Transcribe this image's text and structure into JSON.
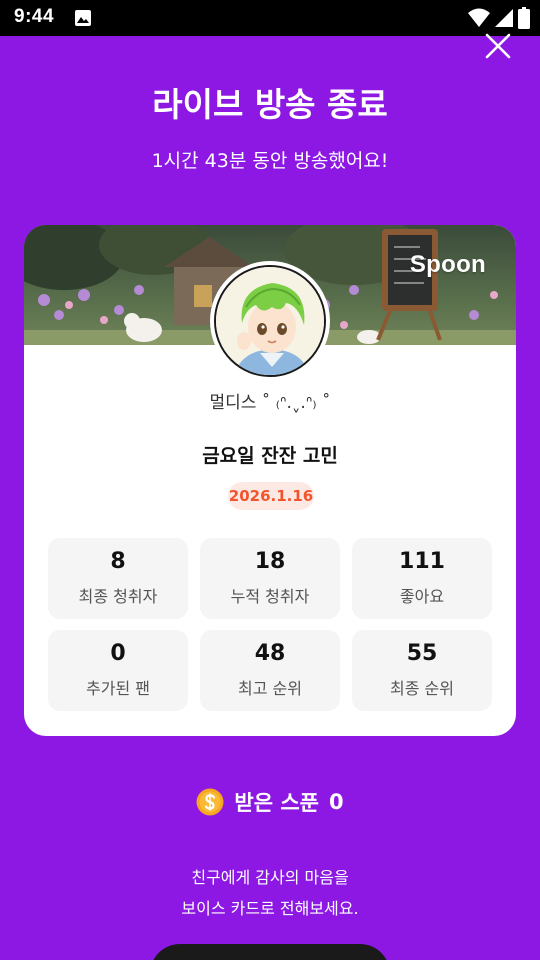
{
  "status_bar": {
    "time": "9:44",
    "icons": [
      "gallery-icon",
      "wifi-icon",
      "signal-icon",
      "battery-icon"
    ]
  },
  "header": {
    "title": "라이브 방송 종료",
    "subtitle": "1시간 43분 동안 방송했어요!",
    "close_icon": "close-icon"
  },
  "card": {
    "brand": "Spoon",
    "nickname": "멀디스 ˚ ₍ᐢ.ˬ.ᐢ₎ ˚",
    "show_title": "금요일 잔잔 고민",
    "date": "2026.1.16",
    "stats": [
      {
        "value": "8",
        "label": "최종 청취자"
      },
      {
        "value": "18",
        "label": "누적 청취자"
      },
      {
        "value": "111",
        "label": "좋아요"
      },
      {
        "value": "0",
        "label": "추가된 팬"
      },
      {
        "value": "48",
        "label": "최고 순위"
      },
      {
        "value": "55",
        "label": "최종 순위"
      }
    ]
  },
  "spoons": {
    "icon": "spoon-coin-icon",
    "label": "받은 스푼",
    "count": "0"
  },
  "thanks": {
    "line1": "친구에게 감사의 마음을",
    "line2": "보이스 카드로 전해보세요."
  },
  "colors": {
    "background": "#8d18e4",
    "date_badge_text": "#f2542d",
    "date_badge_bg": "#fde9e3",
    "coin": "#f5a623"
  }
}
